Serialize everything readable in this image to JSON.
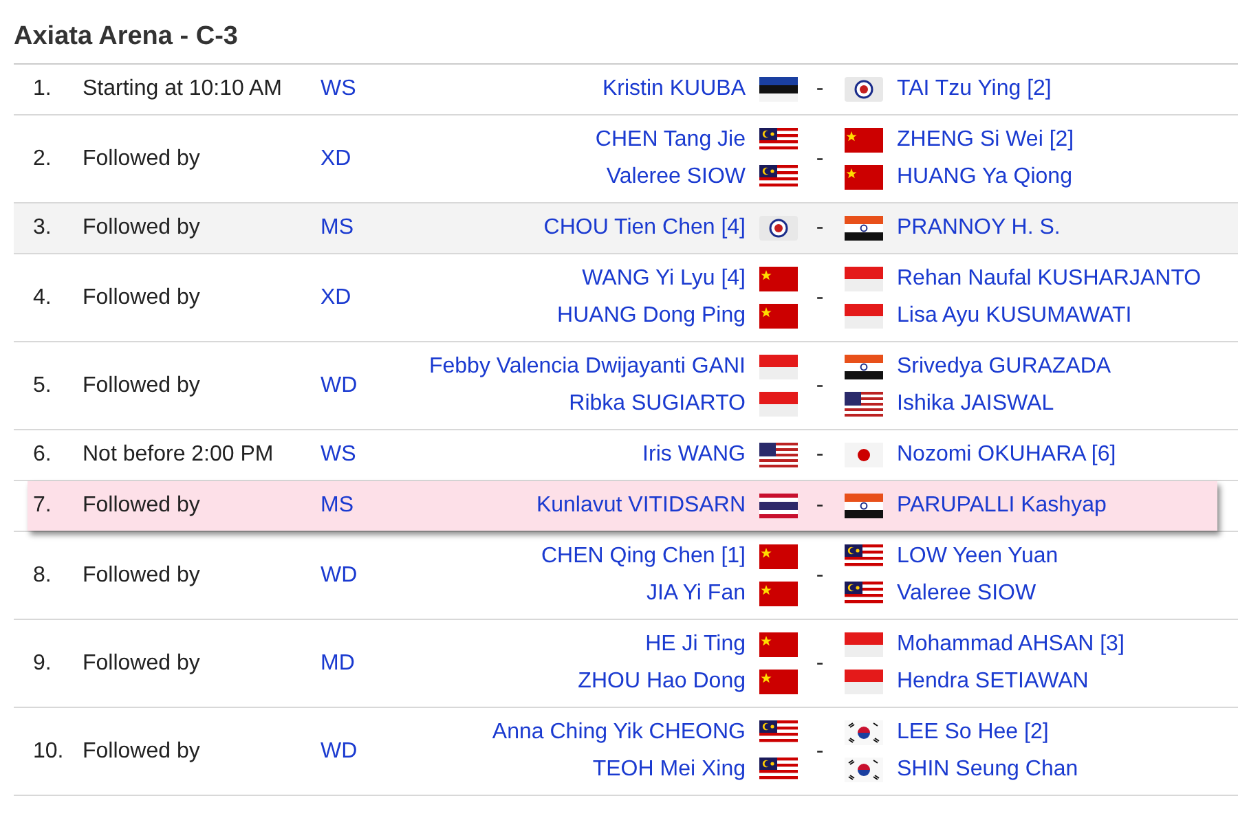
{
  "heading": "Axiata Arena - C-3",
  "matches": [
    {
      "number": "1.",
      "status": "Starting at 10:10 AM",
      "event": "WS",
      "shaded": false,
      "highlighted": false,
      "separator": "-",
      "left": [
        {
          "name": "Kristin KUUBA",
          "kind": "est"
        }
      ],
      "right": [
        {
          "name": "TAI Tzu Ying [2]",
          "kind": "tpe"
        }
      ]
    },
    {
      "number": "2.",
      "status": "Followed by",
      "event": "XD",
      "shaded": false,
      "highlighted": false,
      "separator": "-",
      "left": [
        {
          "name": "CHEN Tang Jie",
          "kind": "mas"
        },
        {
          "name": "Valeree SIOW",
          "kind": "mas"
        }
      ],
      "right": [
        {
          "name": "ZHENG Si Wei [2]",
          "kind": "chn"
        },
        {
          "name": "HUANG Ya Qiong",
          "kind": "chn"
        }
      ]
    },
    {
      "number": "3.",
      "status": "Followed by",
      "event": "MS",
      "shaded": true,
      "highlighted": false,
      "separator": "-",
      "left": [
        {
          "name": "CHOU Tien Chen [4]",
          "kind": "tpe"
        }
      ],
      "right": [
        {
          "name": "PRANNOY H. S.",
          "kind": "ind"
        }
      ]
    },
    {
      "number": "4.",
      "status": "Followed by",
      "event": "XD",
      "shaded": false,
      "highlighted": false,
      "separator": "-",
      "left": [
        {
          "name": "WANG Yi Lyu [4]",
          "kind": "chn"
        },
        {
          "name": "HUANG Dong Ping",
          "kind": "chn"
        }
      ],
      "right": [
        {
          "name": "Rehan Naufal KUSHARJANTO",
          "kind": "ina"
        },
        {
          "name": "Lisa Ayu KUSUMAWATI",
          "kind": "ina"
        }
      ]
    },
    {
      "number": "5.",
      "status": "Followed by",
      "event": "WD",
      "shaded": false,
      "highlighted": false,
      "separator": "-",
      "left": [
        {
          "name": "Febby Valencia Dwijayanti GANI",
          "kind": "ina"
        },
        {
          "name": "Ribka SUGIARTO",
          "kind": "ina"
        }
      ],
      "right": [
        {
          "name": "Srivedya GURAZADA",
          "kind": "ind"
        },
        {
          "name": "Ishika JAISWAL",
          "kind": "usa"
        }
      ]
    },
    {
      "number": "6.",
      "status": "Not before 2:00 PM",
      "event": "WS",
      "shaded": false,
      "highlighted": false,
      "separator": "-",
      "left": [
        {
          "name": "Iris WANG",
          "kind": "usa"
        }
      ],
      "right": [
        {
          "name": "Nozomi OKUHARA [6]",
          "kind": "jpn"
        }
      ]
    },
    {
      "number": "7.",
      "status": "Followed by",
      "event": "MS",
      "shaded": false,
      "highlighted": true,
      "separator": "-",
      "left": [
        {
          "name": "Kunlavut VITIDSARN",
          "kind": "tha"
        }
      ],
      "right": [
        {
          "name": "PARUPALLI Kashyap",
          "kind": "ind"
        }
      ]
    },
    {
      "number": "8.",
      "status": "Followed by",
      "event": "WD",
      "shaded": false,
      "highlighted": false,
      "separator": "-",
      "left": [
        {
          "name": "CHEN Qing Chen [1]",
          "kind": "chn"
        },
        {
          "name": "JIA Yi Fan",
          "kind": "chn"
        }
      ],
      "right": [
        {
          "name": "LOW Yeen Yuan",
          "kind": "mas"
        },
        {
          "name": "Valeree SIOW",
          "kind": "mas"
        }
      ]
    },
    {
      "number": "9.",
      "status": "Followed by",
      "event": "MD",
      "shaded": false,
      "highlighted": false,
      "separator": "-",
      "left": [
        {
          "name": "HE Ji Ting",
          "kind": "chn"
        },
        {
          "name": "ZHOU Hao Dong",
          "kind": "chn"
        }
      ],
      "right": [
        {
          "name": "Mohammad AHSAN [3]",
          "kind": "ina"
        },
        {
          "name": "Hendra SETIAWAN",
          "kind": "ina"
        }
      ]
    },
    {
      "number": "10.",
      "status": "Followed by",
      "event": "WD",
      "shaded": false,
      "highlighted": false,
      "separator": "-",
      "left": [
        {
          "name": "Anna Ching Yik CHEONG",
          "kind": "mas"
        },
        {
          "name": "TEOH Mei Xing",
          "kind": "mas"
        }
      ],
      "right": [
        {
          "name": "LEE So Hee [2]",
          "kind": "kor"
        },
        {
          "name": "SHIN Seung Chan",
          "kind": "kor"
        }
      ]
    }
  ]
}
